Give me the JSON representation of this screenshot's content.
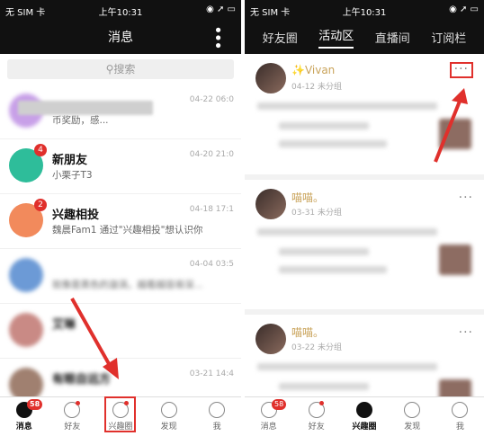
{
  "left_phone": {
    "status": {
      "carrier": "无 SIM 卡",
      "time": "上午10:31"
    },
    "title": "消息",
    "search_placeholder": "搜索",
    "messages": [
      {
        "name": "",
        "time": "04-22 06:0",
        "preview": "币奖励，感...",
        "badge": "",
        "avatar_color": "#c8a0e8"
      },
      {
        "name": "新朋友",
        "time": "04-20 21:0",
        "preview": "小栗子T3",
        "badge": "4",
        "avatar_color": "#2ebd9a"
      },
      {
        "name": "兴趣相投",
        "time": "04-18 17:1",
        "preview": "魏晨Fam1 通过\"兴趣相投\"想认识你",
        "badge": "2",
        "avatar_color": "#f28a5c"
      },
      {
        "name": "",
        "time": "04-04 03:5",
        "preview": "就像是黑色的漩涡，越看越容易深...",
        "badge": "",
        "avatar_color": "#6c9ad6"
      },
      {
        "name": "艾琳",
        "time": "",
        "preview": "",
        "badge": "",
        "avatar_color": "#c98a85"
      },
      {
        "name": "有眼自远方",
        "time": "03-21 14:4",
        "preview": "",
        "badge": "",
        "avatar_color": "#a08070"
      }
    ],
    "tabbar": [
      {
        "label": "消息",
        "badge": "58",
        "selected": true
      },
      {
        "label": "好友",
        "badge": "",
        "dot": true
      },
      {
        "label": "兴趣圈",
        "badge": "",
        "dot": true
      },
      {
        "label": "发现",
        "badge": ""
      },
      {
        "label": "我",
        "badge": ""
      }
    ]
  },
  "right_phone": {
    "status": {
      "carrier": "无 SIM 卡",
      "time": "上午10:31"
    },
    "tabs": [
      "好友圈",
      "活动区",
      "直播间",
      "订阅栏"
    ],
    "active_tab": "活动区",
    "posts": [
      {
        "name": "✨Vivan",
        "date": "04-12",
        "category": "未分组"
      },
      {
        "name": "喵喵。",
        "date": "03-31",
        "category": "未分组"
      },
      {
        "name": "喵喵。",
        "date": "03-22",
        "category": "未分组"
      }
    ],
    "tabbar": [
      {
        "label": "消息",
        "badge": "58"
      },
      {
        "label": "好友",
        "badge": "",
        "dot": true
      },
      {
        "label": "兴趣圈",
        "badge": "",
        "selected": true
      },
      {
        "label": "发现",
        "badge": ""
      },
      {
        "label": "我",
        "badge": ""
      }
    ]
  },
  "colors": {
    "accent": "#e0302c",
    "topbar": "#111111"
  }
}
